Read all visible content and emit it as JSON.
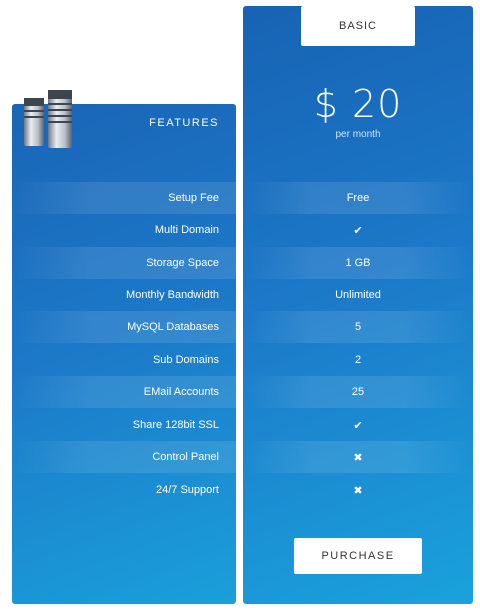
{
  "features": {
    "title": "FEATURES",
    "items": [
      "Setup Fee",
      "Multi Domain",
      "Storage Space",
      "Monthly Bandwidth",
      "MySQL Databases",
      "Sub Domains",
      "EMail Accounts",
      "Share 128bit SSL",
      "Control Panel",
      "24/7 Support"
    ]
  },
  "plan": {
    "name": "BASIC",
    "price": "$ 20",
    "period": "per month",
    "values": [
      {
        "text": "Free"
      },
      {
        "icon": "check-icon",
        "glyph": "✔"
      },
      {
        "text": "1 GB"
      },
      {
        "text": "Unlimited"
      },
      {
        "text": "5"
      },
      {
        "text": "2"
      },
      {
        "text": "25"
      },
      {
        "icon": "check-icon",
        "glyph": "✔"
      },
      {
        "icon": "cross-icon",
        "glyph": "✖"
      },
      {
        "icon": "cross-icon",
        "glyph": "✖"
      }
    ],
    "purchase_label": "PURCHASE"
  },
  "colors": {
    "panel_top": "#1763b4",
    "panel_bottom": "#1aa2dc",
    "button_bg": "#ffffff",
    "button_text": "#333333"
  }
}
